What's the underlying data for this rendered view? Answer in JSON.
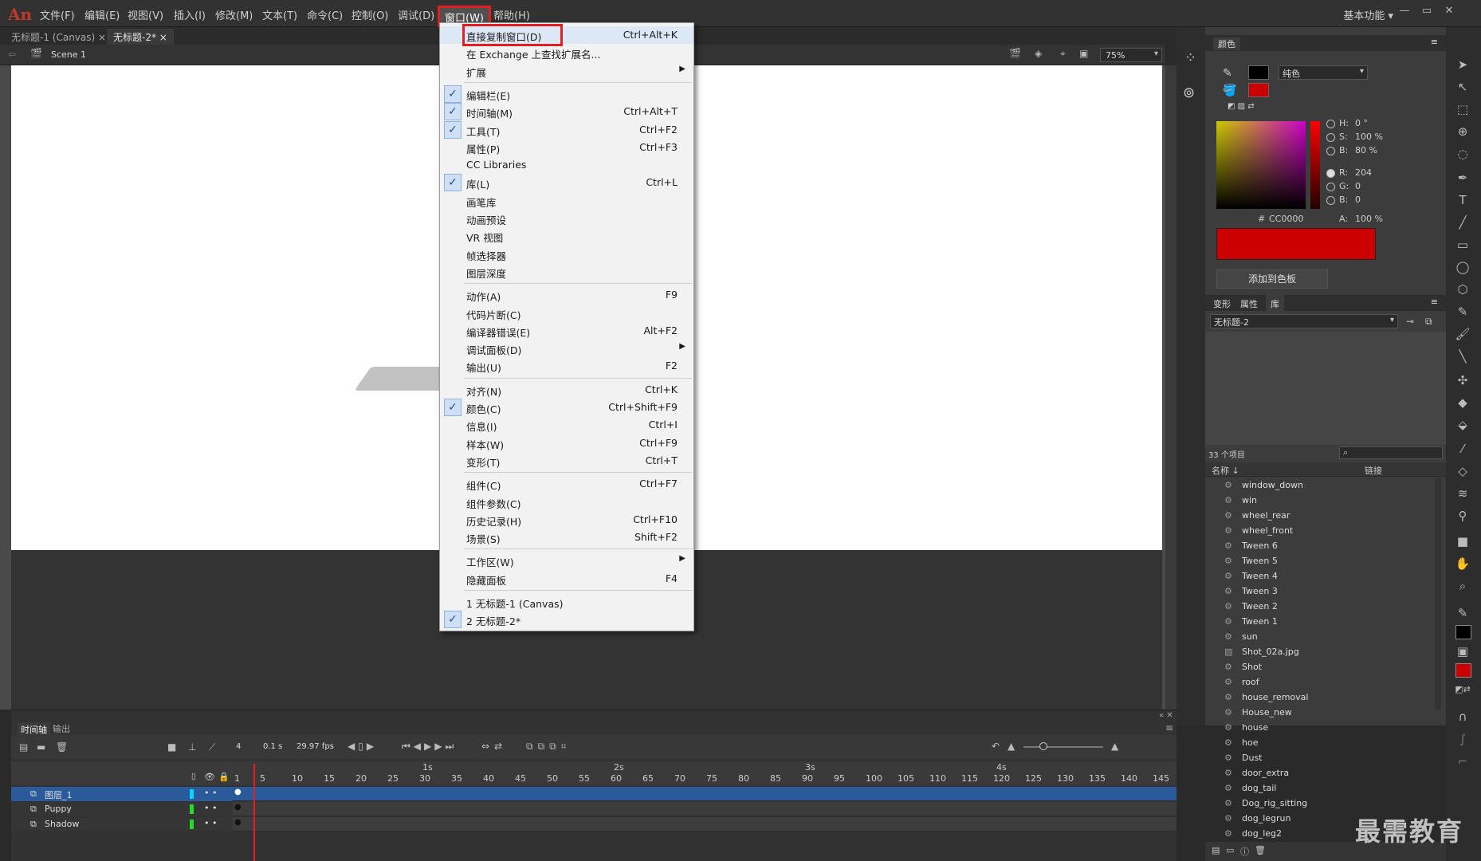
{
  "app": {
    "logo": "An",
    "workspace": "基本功能",
    "workspace_arrow": "▾"
  },
  "menubar": [
    "文件(F)",
    "编辑(E)",
    "视图(V)",
    "插入(I)",
    "修改(M)",
    "文本(T)",
    "命令(C)",
    "控制(O)",
    "调试(D)",
    "窗口(W)",
    "帮助(H)"
  ],
  "window_controls": [
    "—",
    "▭",
    "✕"
  ],
  "doc_tabs": [
    "无标题-1 (Canvas)",
    "无标题-2*"
  ],
  "scene": {
    "name": "Scene 1",
    "zoom": "75%"
  },
  "window_menu": {
    "items": [
      {
        "label": "直接复制窗口(D)",
        "shortcut": "Ctrl+Alt+K",
        "checked": false,
        "highlight": true
      },
      {
        "label": "在 Exchange 上查找扩展名...",
        "shortcut": "",
        "checked": false
      },
      {
        "label": "扩展",
        "shortcut": "",
        "checked": false,
        "submenu": true
      },
      {
        "sep": true
      },
      {
        "label": "编辑栏(E)",
        "shortcut": "",
        "checked": true
      },
      {
        "label": "时间轴(M)",
        "shortcut": "Ctrl+Alt+T",
        "checked": true
      },
      {
        "label": "工具(T)",
        "shortcut": "Ctrl+F2",
        "checked": true
      },
      {
        "label": "属性(P)",
        "shortcut": "Ctrl+F3",
        "checked": false
      },
      {
        "label": "CC Libraries",
        "shortcut": "",
        "checked": false
      },
      {
        "label": "库(L)",
        "shortcut": "Ctrl+L",
        "checked": true
      },
      {
        "label": "画笔库",
        "shortcut": "",
        "checked": false
      },
      {
        "label": "动画预设",
        "shortcut": "",
        "checked": false
      },
      {
        "label": "VR 视图",
        "shortcut": "",
        "checked": false
      },
      {
        "label": "帧选择器",
        "shortcut": "",
        "checked": false
      },
      {
        "label": "图层深度",
        "shortcut": "",
        "checked": false
      },
      {
        "sep": true
      },
      {
        "label": "动作(A)",
        "shortcut": "F9",
        "checked": false
      },
      {
        "label": "代码片断(C)",
        "shortcut": "",
        "checked": false
      },
      {
        "label": "编译器错误(E)",
        "shortcut": "Alt+F2",
        "checked": false
      },
      {
        "label": "调试面板(D)",
        "shortcut": "",
        "checked": false,
        "submenu": true
      },
      {
        "label": "输出(U)",
        "shortcut": "F2",
        "checked": false
      },
      {
        "sep": true
      },
      {
        "label": "对齐(N)",
        "shortcut": "Ctrl+K",
        "checked": false
      },
      {
        "label": "颜色(C)",
        "shortcut": "Ctrl+Shift+F9",
        "checked": true
      },
      {
        "label": "信息(I)",
        "shortcut": "Ctrl+I",
        "checked": false
      },
      {
        "label": "样本(W)",
        "shortcut": "Ctrl+F9",
        "checked": false
      },
      {
        "label": "变形(T)",
        "shortcut": "Ctrl+T",
        "checked": false
      },
      {
        "sep": true
      },
      {
        "label": "组件(C)",
        "shortcut": "Ctrl+F7",
        "checked": false
      },
      {
        "label": "组件参数(C)",
        "shortcut": "",
        "checked": false
      },
      {
        "label": "历史记录(H)",
        "shortcut": "Ctrl+F10",
        "checked": false
      },
      {
        "label": "场景(S)",
        "shortcut": "Shift+F2",
        "checked": false
      },
      {
        "sep": true
      },
      {
        "label": "工作区(W)",
        "shortcut": "",
        "checked": false,
        "submenu": true
      },
      {
        "label": "隐藏面板",
        "shortcut": "F4",
        "checked": false
      },
      {
        "sep": true
      },
      {
        "label": "1 无标题-1 (Canvas)",
        "shortcut": "",
        "checked": false
      },
      {
        "label": "2 无标题-2*",
        "shortcut": "",
        "checked": true
      }
    ]
  },
  "color_panel": {
    "title": "颜色",
    "fill_type": "纯色",
    "H": "0 °",
    "S": "100 %",
    "B": "80 %",
    "R": "204",
    "G": "0",
    "Bv": "0",
    "hex_label": "#",
    "hex": "CC0000",
    "A": "100 %",
    "add_button": "添加到色板",
    "labels": {
      "H": "H:",
      "S": "S:",
      "B": "B:",
      "R": "R:",
      "G": "G:",
      "Bc": "B:",
      "A": "A:"
    },
    "swatch_color": "#cc0000"
  },
  "library_panel": {
    "tabs": [
      "变形",
      "属性",
      "库"
    ],
    "doc": "无标题-2",
    "count": "33 个项目",
    "col_name": "名称 ↓",
    "col_link": "链接",
    "items": [
      {
        "name": "window_down",
        "icon": "symbol"
      },
      {
        "name": "win",
        "icon": "symbol"
      },
      {
        "name": "wheel_rear",
        "icon": "symbol"
      },
      {
        "name": "wheel_front",
        "icon": "symbol"
      },
      {
        "name": "Tween 6",
        "icon": "symbol"
      },
      {
        "name": "Tween 5",
        "icon": "symbol"
      },
      {
        "name": "Tween 4",
        "icon": "symbol"
      },
      {
        "name": "Tween 3",
        "icon": "symbol"
      },
      {
        "name": "Tween 2",
        "icon": "symbol"
      },
      {
        "name": "Tween 1",
        "icon": "symbol"
      },
      {
        "name": "sun",
        "icon": "symbol"
      },
      {
        "name": "Shot_02a.jpg",
        "icon": "bitmap"
      },
      {
        "name": "Shot",
        "icon": "symbol"
      },
      {
        "name": "roof",
        "icon": "symbol"
      },
      {
        "name": "house_removal",
        "icon": "symbol"
      },
      {
        "name": "House_new",
        "icon": "symbol"
      },
      {
        "name": "house",
        "icon": "symbol"
      },
      {
        "name": "hoe",
        "icon": "symbol"
      },
      {
        "name": "Dust",
        "icon": "symbol"
      },
      {
        "name": "door_extra",
        "icon": "symbol"
      },
      {
        "name": "dog_tail",
        "icon": "symbol"
      },
      {
        "name": "Dog_rig_sitting",
        "icon": "symbol"
      },
      {
        "name": "dog_legrun",
        "icon": "symbol"
      },
      {
        "name": "dog_leg2",
        "icon": "symbol"
      }
    ]
  },
  "timeline": {
    "tabs": [
      "时间轴",
      "输出"
    ],
    "frame": "4",
    "time": "0.1 s",
    "fps": "29.97 fps",
    "layers": [
      {
        "name": "图层_1",
        "color": "#00d8ff",
        "selected": true
      },
      {
        "name": "Puppy",
        "color": "#22dd22",
        "selected": false
      },
      {
        "name": "Shadow",
        "color": "#22dd22",
        "selected": false
      }
    ],
    "frame_ticks": [
      "1",
      "5",
      "10",
      "15",
      "20",
      "25",
      "30",
      "35",
      "40",
      "45",
      "50",
      "55",
      "60",
      "65",
      "70",
      "75",
      "80",
      "85",
      "90",
      "95",
      "100",
      "105",
      "110",
      "115",
      "120",
      "125",
      "130",
      "135",
      "140",
      "145"
    ],
    "seconds": [
      "1s",
      "2s",
      "3s",
      "4s"
    ]
  },
  "watermark": "最需教育"
}
